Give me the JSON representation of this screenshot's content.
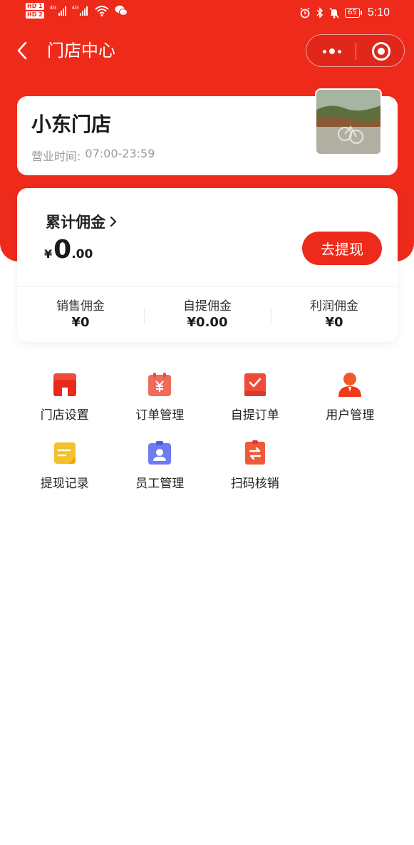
{
  "status_bar": {
    "hd1": "HD 1",
    "hd2": "HD 2",
    "net1": "4G",
    "net2": "4G",
    "battery": "65",
    "time": "5:10"
  },
  "nav": {
    "title": "门店中心"
  },
  "store": {
    "name": "小东门店",
    "hours_label": "营业时间:",
    "hours_value": "07:00-23:59"
  },
  "commission": {
    "title": "累计佣金",
    "currency": "¥",
    "amount_int": "0",
    "amount_dec": ".00",
    "withdraw_label": "去提现",
    "stats": [
      {
        "label": "销售佣金",
        "value": "¥0"
      },
      {
        "label": "自提佣金",
        "value": "¥0.00"
      },
      {
        "label": "利润佣金",
        "value": "¥0"
      }
    ]
  },
  "menu": [
    {
      "label": "门店设置",
      "icon": "store-icon",
      "color": "#ef3b2d"
    },
    {
      "label": "订单管理",
      "icon": "order-icon",
      "color": "#f06a5a"
    },
    {
      "label": "自提订单",
      "icon": "pickup-order-icon",
      "color": "#ef4a3a"
    },
    {
      "label": "用户管理",
      "icon": "user-icon",
      "color": "#f0502a"
    },
    {
      "label": "提现记录",
      "icon": "withdraw-record-icon",
      "color": "#f5b323"
    },
    {
      "label": "员工管理",
      "icon": "staff-icon",
      "color": "#6d7cf0"
    },
    {
      "label": "扫码核销",
      "icon": "scan-verify-icon",
      "color": "#ef5a3a"
    }
  ],
  "colors": {
    "brand": "#ee2a1b"
  }
}
